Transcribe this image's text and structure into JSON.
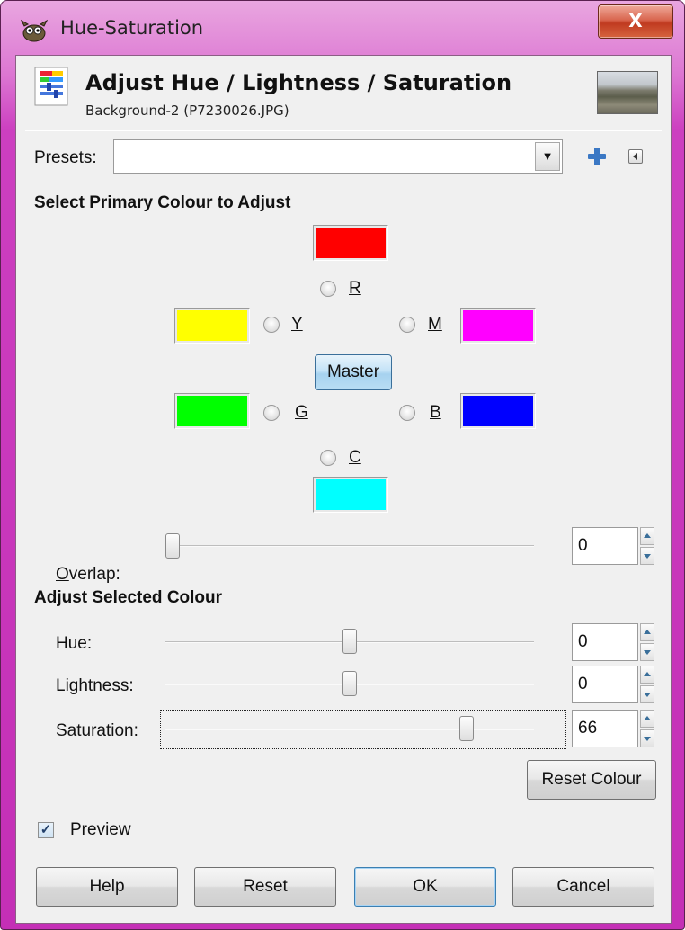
{
  "window": {
    "title": "Hue-Saturation",
    "close_label": "X"
  },
  "header": {
    "title": "Adjust Hue / Lightness / Saturation",
    "subtitle": "Background-2 (P7230026.JPG)"
  },
  "presets": {
    "label": "Presets:",
    "value": ""
  },
  "primary": {
    "section_title": "Select Primary Colour to Adjust",
    "r_label": "R",
    "y_label": "Y",
    "m_label": "M",
    "g_label": "G",
    "b_label": "B",
    "c_label": "C",
    "master_label": "Master",
    "colors": {
      "r": "#ff0000",
      "y": "#ffff00",
      "m": "#ff00ff",
      "g": "#00ff00",
      "b": "#0000ff",
      "c": "#00ffff"
    }
  },
  "overlap": {
    "label": "Overlap:",
    "value": "0",
    "fraction": 0
  },
  "adjust": {
    "section_title": "Adjust Selected Colour",
    "hue": {
      "label": "Hue:",
      "value": "0",
      "fraction": 0.5
    },
    "lightness": {
      "label": "Lightness:",
      "value": "0",
      "fraction": 0.5
    },
    "saturation": {
      "label": "Saturation:",
      "value": "66",
      "fraction": 0.83
    },
    "reset_colour_label": "Reset Colour"
  },
  "preview": {
    "label": "Preview",
    "checked": true
  },
  "buttons": {
    "help": "Help",
    "reset": "Reset",
    "ok": "OK",
    "cancel": "Cancel"
  },
  "icons": {
    "app": "gimp-wilber-icon",
    "header": "hue-saturation-tool-icon",
    "add": "add-preset-icon",
    "menu": "preset-menu-icon"
  }
}
